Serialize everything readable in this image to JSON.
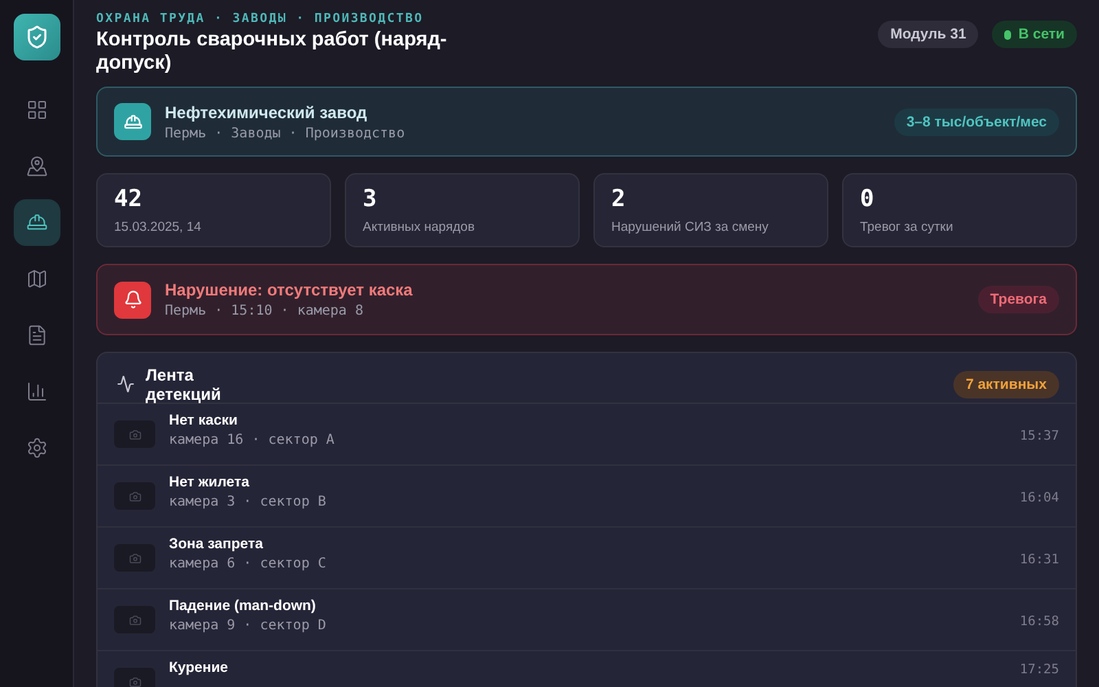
{
  "sidebar": {
    "items": [
      {
        "selected": false
      },
      {
        "selected": false
      },
      {
        "selected": true
      },
      {
        "selected": false
      },
      {
        "selected": false
      },
      {
        "selected": false
      },
      {
        "selected": false
      }
    ]
  },
  "header": {
    "breadcrumb": "ОХРАНА ТРУДА · ЗАВОДЫ · ПРОИЗВОДСТВО",
    "title": "Контроль сварочных работ (наряд-допуск)",
    "module": "Модуль 31",
    "status": {
      "label": "В сети",
      "online": true
    }
  },
  "site": {
    "name": "Нефтехимический завод",
    "path": "Пермь · Заводы · Производство",
    "price": "3–8 тыс/объект/мес"
  },
  "stats": [
    {
      "value": "42",
      "label": "15.03.2025, 14"
    },
    {
      "value": "3",
      "label": "Активных нарядов"
    },
    {
      "value": "2",
      "label": "Нарушений СИЗ за смену"
    },
    {
      "value": "0",
      "label": "Тревог за сутки"
    }
  ],
  "alert": {
    "title": "Нарушение: отсутствует каска",
    "details": "Пермь · 15:10 · камера 8",
    "level": "Тревога"
  },
  "feed": {
    "title": "Лента детекций",
    "count": "7 активных",
    "rows": [
      {
        "title": "Нет каски",
        "source": "камера 16 · сектор A",
        "time": "15:37"
      },
      {
        "title": "Нет жилета",
        "source": "камера 3 · сектор B",
        "time": "16:04"
      },
      {
        "title": "Зона запрета",
        "source": "камера 6 · сектор C",
        "time": "16:31"
      },
      {
        "title": "Падение (man-down)",
        "source": "камера 9 · сектор D",
        "time": "16:58"
      },
      {
        "title": "Курение",
        "time": "17:25"
      }
    ]
  }
}
